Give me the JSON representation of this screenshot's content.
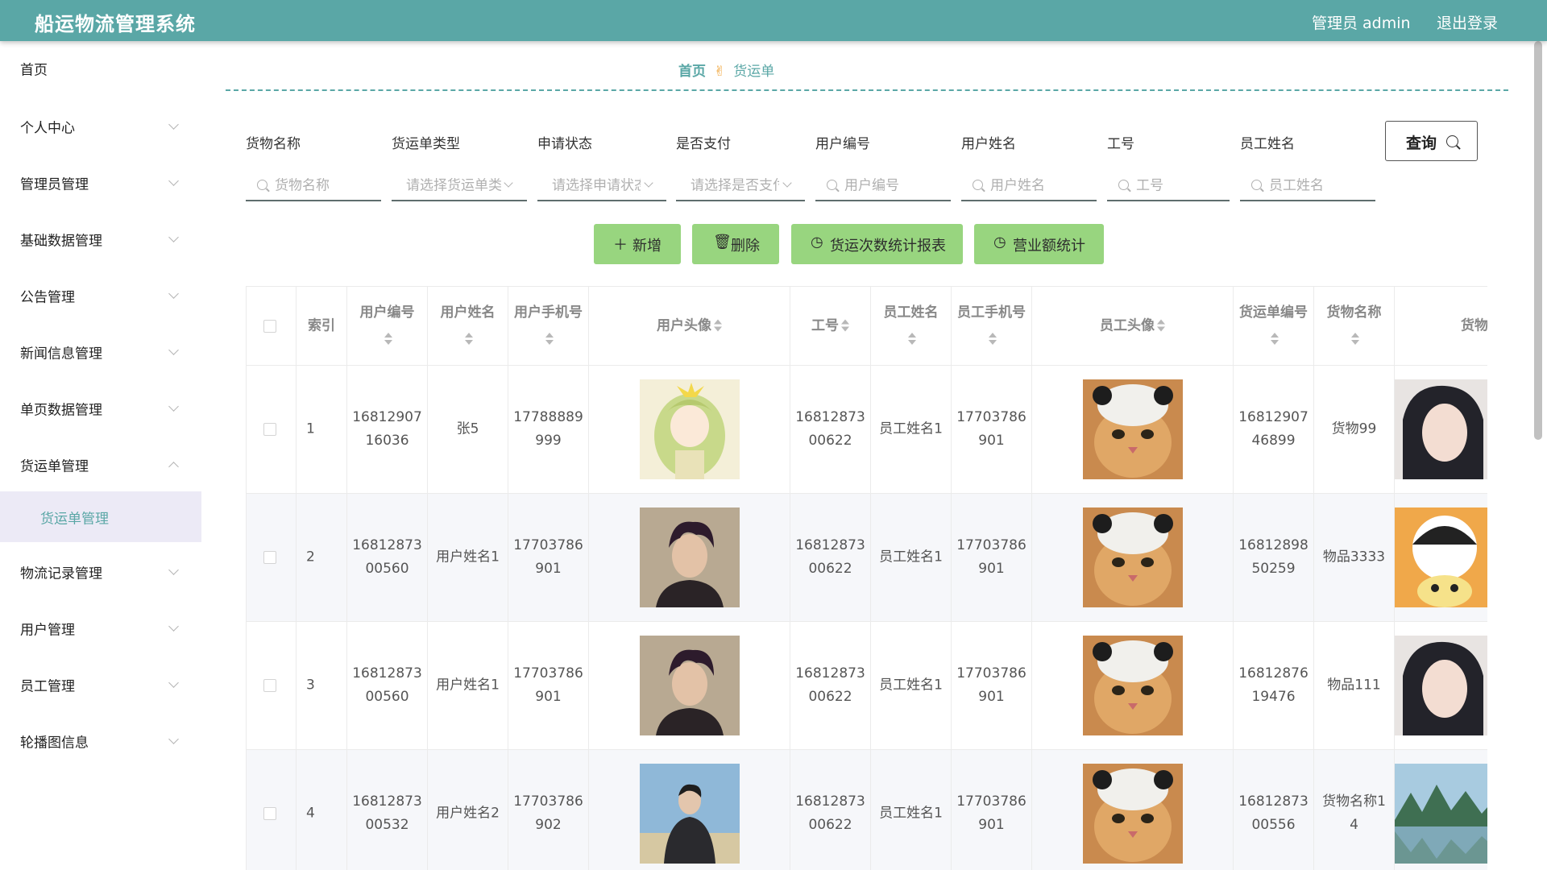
{
  "header": {
    "app_title": "船运物流管理系统",
    "admin_label": "管理员 admin",
    "logout_label": "退出登录"
  },
  "sidebar": {
    "items": [
      {
        "label": "首页",
        "chevron": false
      },
      {
        "label": "个人中心",
        "chevron": true
      },
      {
        "label": "管理员管理",
        "chevron": true
      },
      {
        "label": "基础数据管理",
        "chevron": true
      },
      {
        "label": "公告管理",
        "chevron": true
      },
      {
        "label": "新闻信息管理",
        "chevron": true
      },
      {
        "label": "单页数据管理",
        "chevron": true
      },
      {
        "label": "货运单管理",
        "chevron": true,
        "expanded": true
      },
      {
        "label": "物流记录管理",
        "chevron": true
      },
      {
        "label": "用户管理",
        "chevron": true
      },
      {
        "label": "员工管理",
        "chevron": true
      },
      {
        "label": "轮播图信息",
        "chevron": true
      }
    ],
    "active_subitem": "货运单管理"
  },
  "breadcrumb": {
    "home": "首页",
    "current": "货运单"
  },
  "search": {
    "fields": [
      {
        "label": "货物名称",
        "placeholder": "货物名称",
        "type": "text"
      },
      {
        "label": "货运单类型",
        "placeholder": "请选择货运单类型",
        "type": "select"
      },
      {
        "label": "申请状态",
        "placeholder": "请选择申请状态",
        "type": "select"
      },
      {
        "label": "是否支付",
        "placeholder": "请选择是否支付",
        "type": "select"
      },
      {
        "label": "用户编号",
        "placeholder": "用户编号",
        "type": "text"
      },
      {
        "label": "用户姓名",
        "placeholder": "用户姓名",
        "type": "text"
      },
      {
        "label": "工号",
        "placeholder": "工号",
        "type": "text"
      },
      {
        "label": "员工姓名",
        "placeholder": "员工姓名",
        "type": "text"
      }
    ],
    "query_label": "查询"
  },
  "actions": {
    "add": "新增",
    "delete": "删除",
    "ship_report": "货运次数统计报表",
    "revenue": "营业额统计"
  },
  "colors": {
    "header_bg": "#5aa7a6",
    "accent": "#5aa7a6",
    "button_green": "#98d57f"
  },
  "table": {
    "columns": [
      "",
      "索引",
      "用户编号",
      "用户姓名",
      "用户手机号",
      "用户头像",
      "工号",
      "员工姓名",
      "员工手机号",
      "员工头像",
      "货运单编号",
      "货物名称",
      "货物"
    ],
    "rows": [
      {
        "index": "1",
        "user_no": "1681290716036",
        "user_name": "张5",
        "user_phone": "17788889999",
        "user_avatar": "anime-girl-avatar",
        "emp_no": "1681287300622",
        "emp_name": "员工姓名1",
        "emp_phone": "17703786901",
        "emp_avatar": "cat-avatar",
        "ship_no": "1681290746899",
        "goods_name": "货物99",
        "goods_img": "woman-portrait"
      },
      {
        "index": "2",
        "user_no": "1681287300560",
        "user_name": "用户姓名1",
        "user_phone": "17703786901",
        "user_avatar": "man-portrait",
        "emp_no": "1681287300622",
        "emp_name": "员工姓名1",
        "emp_phone": "17703786901",
        "emp_avatar": "cat-avatar",
        "ship_no": "1681289850259",
        "goods_name": "物品3333",
        "goods_img": "cartoon-figure"
      },
      {
        "index": "3",
        "user_no": "1681287300560",
        "user_name": "用户姓名1",
        "user_phone": "17703786901",
        "user_avatar": "man-portrait",
        "emp_no": "1681287300622",
        "emp_name": "员工姓名1",
        "emp_phone": "17703786901",
        "emp_avatar": "cat-avatar",
        "ship_no": "1681287619476",
        "goods_name": "物品111",
        "goods_img": "woman-portrait"
      },
      {
        "index": "4",
        "user_no": "1681287300532",
        "user_name": "用户姓名2",
        "user_phone": "17703786902",
        "user_avatar": "man-outdoor-photo",
        "emp_no": "1681287300622",
        "emp_name": "员工姓名1",
        "emp_phone": "17703786901",
        "emp_avatar": "cat-avatar",
        "ship_no": "1681287300556",
        "goods_name": "货物名称14",
        "goods_img": "landscape-photo"
      }
    ]
  }
}
